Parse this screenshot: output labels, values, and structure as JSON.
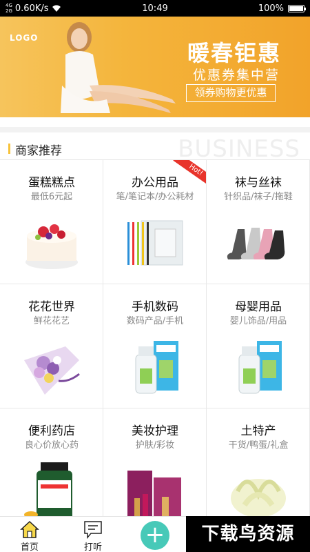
{
  "status": {
    "carrier_tag_top": "4G",
    "carrier_tag_bottom": "2G",
    "speed": "0.60K/s",
    "time": "10:49",
    "battery_text": "100%",
    "battery_level": 1.0
  },
  "banner": {
    "logo": "LOGO",
    "title": "暖春钜惠",
    "subtitle": "优惠券集中营",
    "button": "领券购物更优惠"
  },
  "section": {
    "title": "商家推荐",
    "en_title": "BUSINESS"
  },
  "categories": [
    {
      "name": "蛋糕糕点",
      "desc": "最低6元起",
      "icon": "cake-icon"
    },
    {
      "name": "办公用品",
      "desc": "笔/笔记本/办公耗材",
      "icon": "folders-icon",
      "badge": "Hot!"
    },
    {
      "name": "袜与丝袜",
      "desc": "针织品/袜子/拖鞋",
      "icon": "socks-icon"
    },
    {
      "name": "花花世界",
      "desc": "鲜花花艺",
      "icon": "bouquet-icon"
    },
    {
      "name": "手机数码",
      "desc": "数码产品/手机",
      "icon": "baby-bottle-icon"
    },
    {
      "name": "母婴用品",
      "desc": "婴儿饰品/用品",
      "icon": "baby-bottle-icon"
    },
    {
      "name": "便利药店",
      "desc": "良心价放心药",
      "icon": "medicine-bottle-icon"
    },
    {
      "name": "美妆护理",
      "desc": "护肤/彩妆",
      "icon": "cosmetics-icon"
    },
    {
      "name": "土特产",
      "desc": "干货/鸭蛋/礼盒",
      "icon": "cabbage-icon"
    }
  ],
  "tabbar": {
    "home": "首页",
    "inquire": "打听",
    "add": "+"
  },
  "watermark": "下载鸟资源",
  "colors": {
    "accent": "#f7c23a",
    "fab": "#47c9b8",
    "hot": "#e8342b",
    "banner": "#f4b53c"
  }
}
